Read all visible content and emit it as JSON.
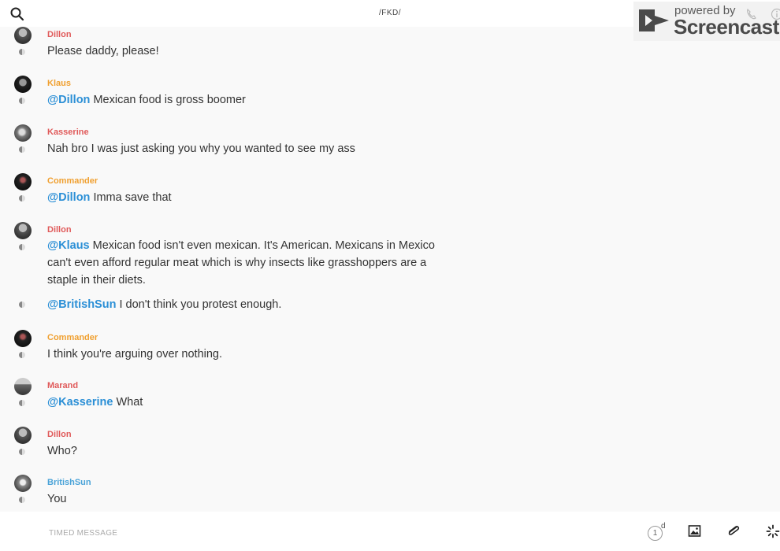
{
  "header": {
    "channel": "/FKD/",
    "watermark": {
      "powered": "powered by",
      "brand": "Screencastify"
    }
  },
  "messages": [
    {
      "author": "Dillon",
      "author_color": "#e05a5a",
      "parts": [
        {
          "text": "Please daddy, please!"
        }
      ]
    },
    {
      "author": "Klaus",
      "author_color": "#f0a030",
      "parts": [
        {
          "mention": "@Dillon"
        },
        {
          "text": " Mexican food is gross boomer"
        }
      ]
    },
    {
      "author": "Kasserine",
      "author_color": "#e05a5a",
      "parts": [
        {
          "text": "Nah bro I was just asking you why you wanted to see my ass"
        }
      ]
    },
    {
      "author": "Commander",
      "author_color": "#f0a030",
      "parts": [
        {
          "mention": "@Dillon"
        },
        {
          "text": " Imma save that"
        }
      ]
    },
    {
      "author": "Dillon",
      "author_color": "#e05a5a",
      "parts": [
        {
          "mention": "@Klaus"
        },
        {
          "text": " Mexican food isn't even mexican. It's American. Mexicans in Mexico can't even afford regular meat which is why insects like grasshoppers are a staple in their diets."
        }
      ]
    },
    {
      "author": "",
      "author_color": "#e05a5a",
      "parts": [
        {
          "mention": "@BritishSun"
        },
        {
          "text": " I don't think you protest enough."
        }
      ]
    },
    {
      "author": "Commander",
      "author_color": "#f0a030",
      "parts": [
        {
          "text": "I think you're arguing over nothing."
        }
      ]
    },
    {
      "author": "Marand",
      "author_color": "#e05a5a",
      "parts": [
        {
          "mention": "@Kasserine"
        },
        {
          "text": " What"
        }
      ]
    },
    {
      "author": "Dillon",
      "author_color": "#e05a5a",
      "parts": [
        {
          "text": "Who?"
        }
      ]
    },
    {
      "author": "BritishSun",
      "author_color": "#4aa3d8",
      "parts": [
        {
          "text": "You"
        }
      ]
    }
  ],
  "composer": {
    "placeholder": "TIMED MESSAGE",
    "timer_value": "1",
    "timer_unit": "d"
  },
  "icons": [
    "search-icon",
    "phone-icon",
    "info-icon",
    "timer-icon",
    "image-icon",
    "paperclip-icon",
    "spinner-icon"
  ]
}
